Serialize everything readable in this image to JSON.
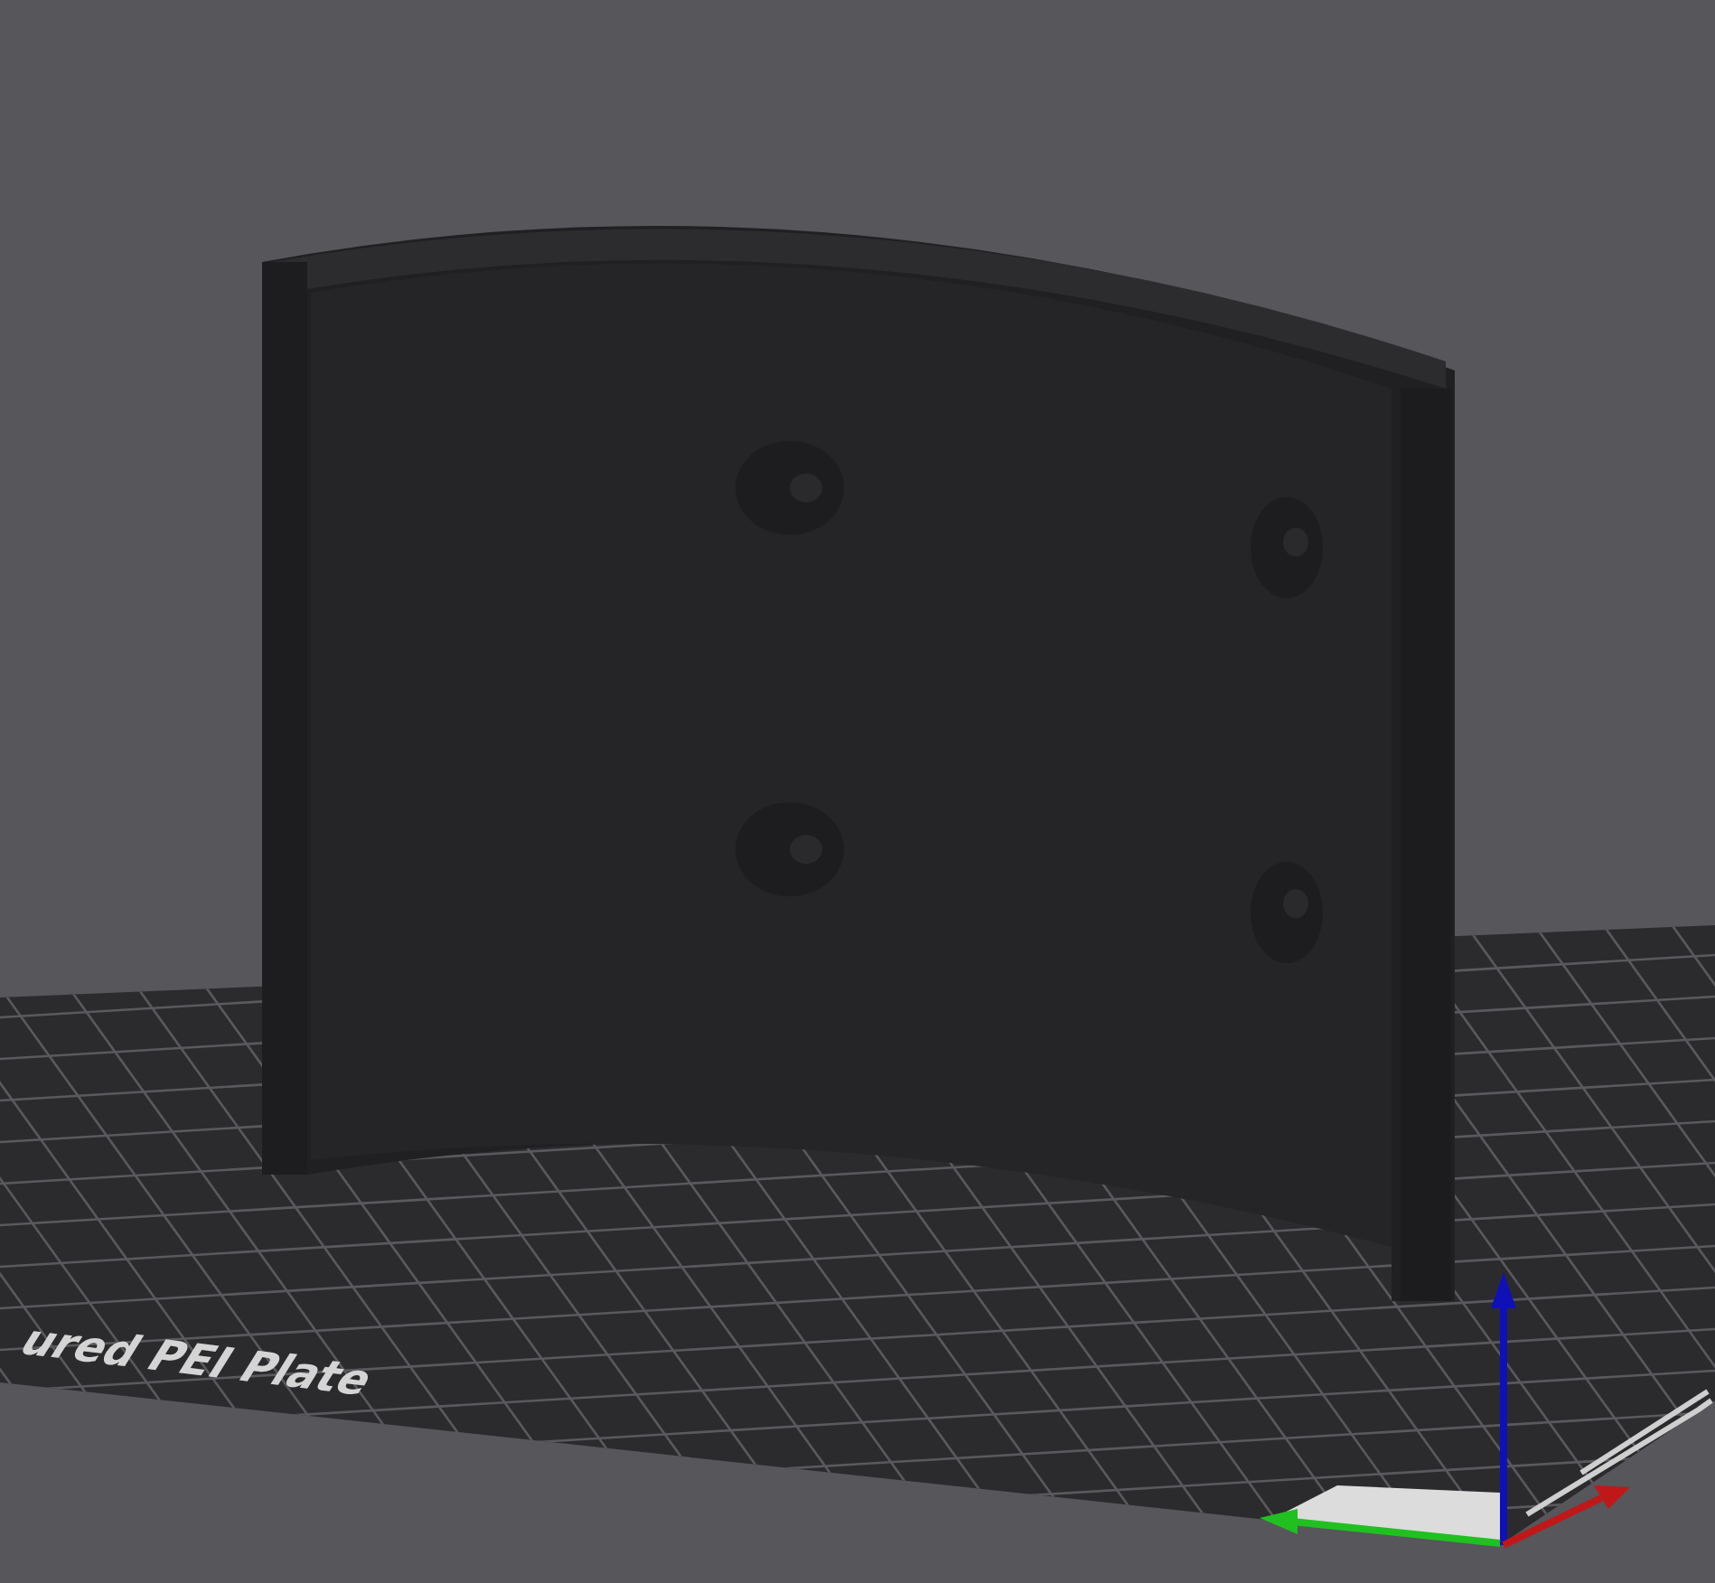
{
  "viewport": {
    "bed_label": "ured PEI Plate"
  }
}
